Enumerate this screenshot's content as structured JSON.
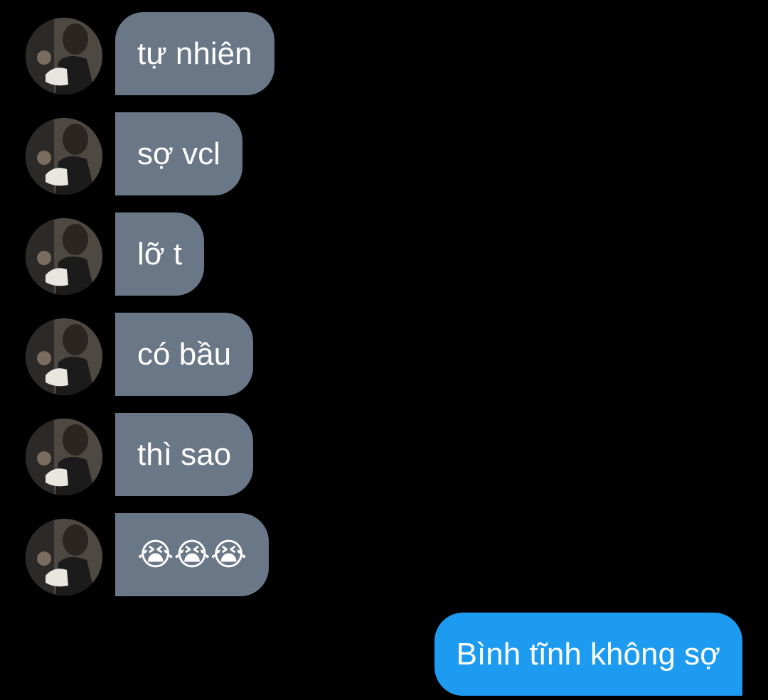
{
  "conversation": {
    "incoming": [
      {
        "text": "tự nhiên"
      },
      {
        "text": "sợ vcl"
      },
      {
        "text": "lỡ t"
      },
      {
        "text": "có bầu"
      },
      {
        "text": "thì sao"
      },
      {
        "text": "😭😭😭"
      }
    ],
    "outgoing": [
      {
        "text": "Bình tĩnh không sợ"
      }
    ]
  },
  "colors": {
    "background": "#000000",
    "incoming_bubble": "#6a7786",
    "outgoing_bubble": "#1d9bf0",
    "text": "#ffffff"
  },
  "icons": {
    "avatar": "user-avatar-photo",
    "emoji": "loudly-crying-face-icon"
  }
}
